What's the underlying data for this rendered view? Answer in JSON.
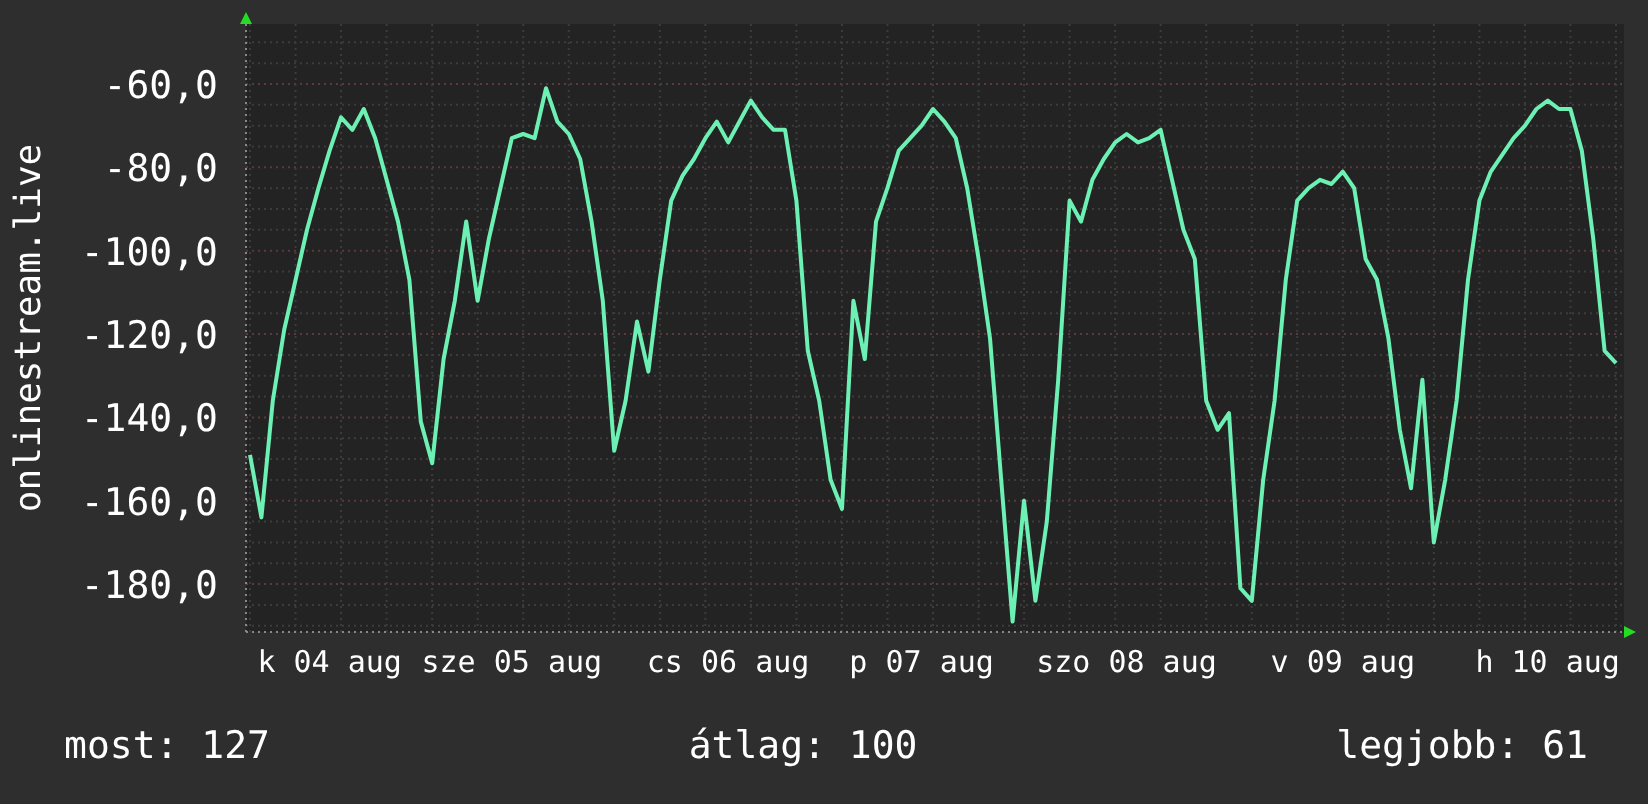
{
  "graph": {
    "chart_data": {
      "type": "line",
      "grid": true,
      "ylabel": "onlinestream.live",
      "ylim": [
        -191.5,
        -45.6
      ],
      "yticks": [
        {
          "value": -180,
          "label": "-180,0"
        },
        {
          "value": -160,
          "label": "-160,0"
        },
        {
          "value": -140,
          "label": "-140,0"
        },
        {
          "value": -120,
          "label": "-120,0"
        },
        {
          "value": -100,
          "label": "-100,0"
        },
        {
          "value": -80,
          "label": "-80,0"
        },
        {
          "value": -60,
          "label": "-60,0"
        }
      ],
      "categories": [
        null,
        null,
        null,
        null,
        null,
        null,
        null,
        "k 04 aug",
        null,
        null,
        null,
        null,
        null,
        null,
        null,
        null,
        null,
        null,
        null,
        null,
        null,
        null,
        null,
        "sze 05 aug",
        null,
        null,
        null,
        null,
        null,
        null,
        null,
        null,
        null,
        null,
        null,
        null,
        null,
        null,
        null,
        null,
        null,
        null,
        "cs 06 aug",
        null,
        null,
        null,
        null,
        null,
        null,
        null,
        null,
        null,
        null,
        null,
        null,
        null,
        null,
        null,
        null,
        "p 07 aug",
        null,
        null,
        null,
        null,
        null,
        null,
        null,
        null,
        null,
        null,
        null,
        null,
        null,
        null,
        null,
        null,
        null,
        "szo 08 aug",
        null,
        null,
        null,
        null,
        null,
        null,
        null,
        null,
        null,
        null,
        null,
        null,
        null,
        null,
        null,
        null,
        null,
        null,
        "v 09 aug",
        null,
        null,
        null,
        null,
        null,
        null,
        null,
        null,
        null,
        null,
        null,
        null,
        null,
        null,
        null,
        null,
        null,
        "h 10 aug",
        null,
        null,
        null,
        null,
        null,
        null
      ],
      "series": [
        {
          "color": "#6df0b4",
          "values": [
            -149,
            -164,
            -136,
            -119,
            -107,
            -95,
            -85,
            -76,
            -68,
            -71,
            -66,
            -73,
            -83,
            -93,
            -107,
            -141,
            -151,
            -126,
            -112,
            -93,
            -112,
            -97,
            -85,
            -73,
            -72,
            -73,
            -61,
            -69,
            -72,
            -78,
            -93,
            -112,
            -148,
            -136,
            -117,
            -129,
            -107,
            -88,
            -82,
            -78,
            -73,
            -69,
            -74,
            -69,
            -64,
            -68,
            -71,
            -71,
            -88,
            -124,
            -136,
            -155,
            -162,
            -112,
            -126,
            -93,
            -85,
            -76,
            -73,
            -70,
            -66,
            -69,
            -73,
            -85,
            -102,
            -121,
            -155,
            -189,
            -160,
            -184,
            -165,
            -131,
            -88,
            -93,
            -83,
            -78,
            -74,
            -72,
            -74,
            -73,
            -71,
            -83,
            -95,
            -102,
            -136,
            -143,
            -139,
            -181,
            -184,
            -155,
            -136,
            -107,
            -88,
            -85,
            -83,
            -84,
            -81,
            -85,
            -102,
            -107,
            -121,
            -143,
            -157,
            -131,
            -170,
            -155,
            -136,
            -107,
            -88,
            -81,
            -77,
            -73,
            -70,
            -66,
            -64,
            -66,
            -66,
            -76,
            -97,
            -124,
            -127
          ]
        }
      ]
    }
  },
  "stats": [
    "most: 127",
    "átlag: 100",
    "legjobb: 61"
  ]
}
